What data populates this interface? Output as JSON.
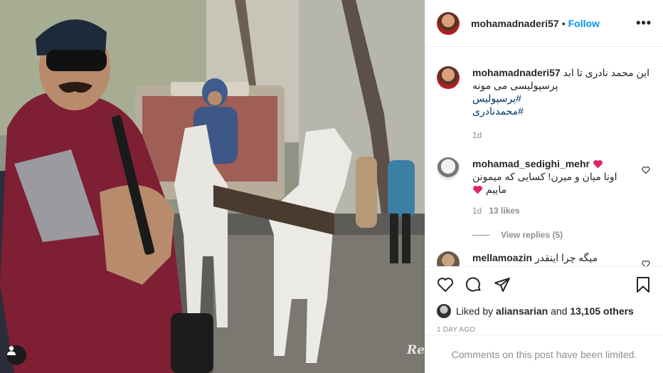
{
  "post": {
    "photo_label": "Post photo",
    "watermark": "Re",
    "user_tag_icon": "person-icon"
  },
  "header": {
    "username": "mohamadnaderi57",
    "separator": "•",
    "follow_label": "Follow",
    "more_label": "•••"
  },
  "caption": {
    "username": "mohamadnaderi57",
    "text": "این محمد نادری تا ابد پرسپولیسی می مونه",
    "hashtags": [
      "#پرسپولیس",
      "#محمدنادری"
    ],
    "time": "1d"
  },
  "comments": [
    {
      "username": "mohamad_sedighi_mehr",
      "text": "اونا میان و میرن! کسایی که میمونن ماییم",
      "time": "1d",
      "likes": "13 likes",
      "view_replies": "View replies (5)"
    },
    {
      "username": "mellamoazin",
      "text": "میگه چرا اینقدر"
    }
  ],
  "actions": {
    "icons": [
      "heart-icon",
      "comment-icon",
      "share-icon",
      "bookmark-icon"
    ],
    "liked_by_prefix": "Liked by",
    "liked_by_user": "aliansarian",
    "liked_by_and": "and",
    "liked_by_others": "13,105 others",
    "time_ago": "1 DAY AGO"
  },
  "footer": {
    "limited_text": "Comments on this post have been limited."
  },
  "colors": {
    "link_blue": "#0095f6",
    "hashtag": "#00376b",
    "heart_red": "#ed4956",
    "secondary": "#8e8e8e"
  }
}
